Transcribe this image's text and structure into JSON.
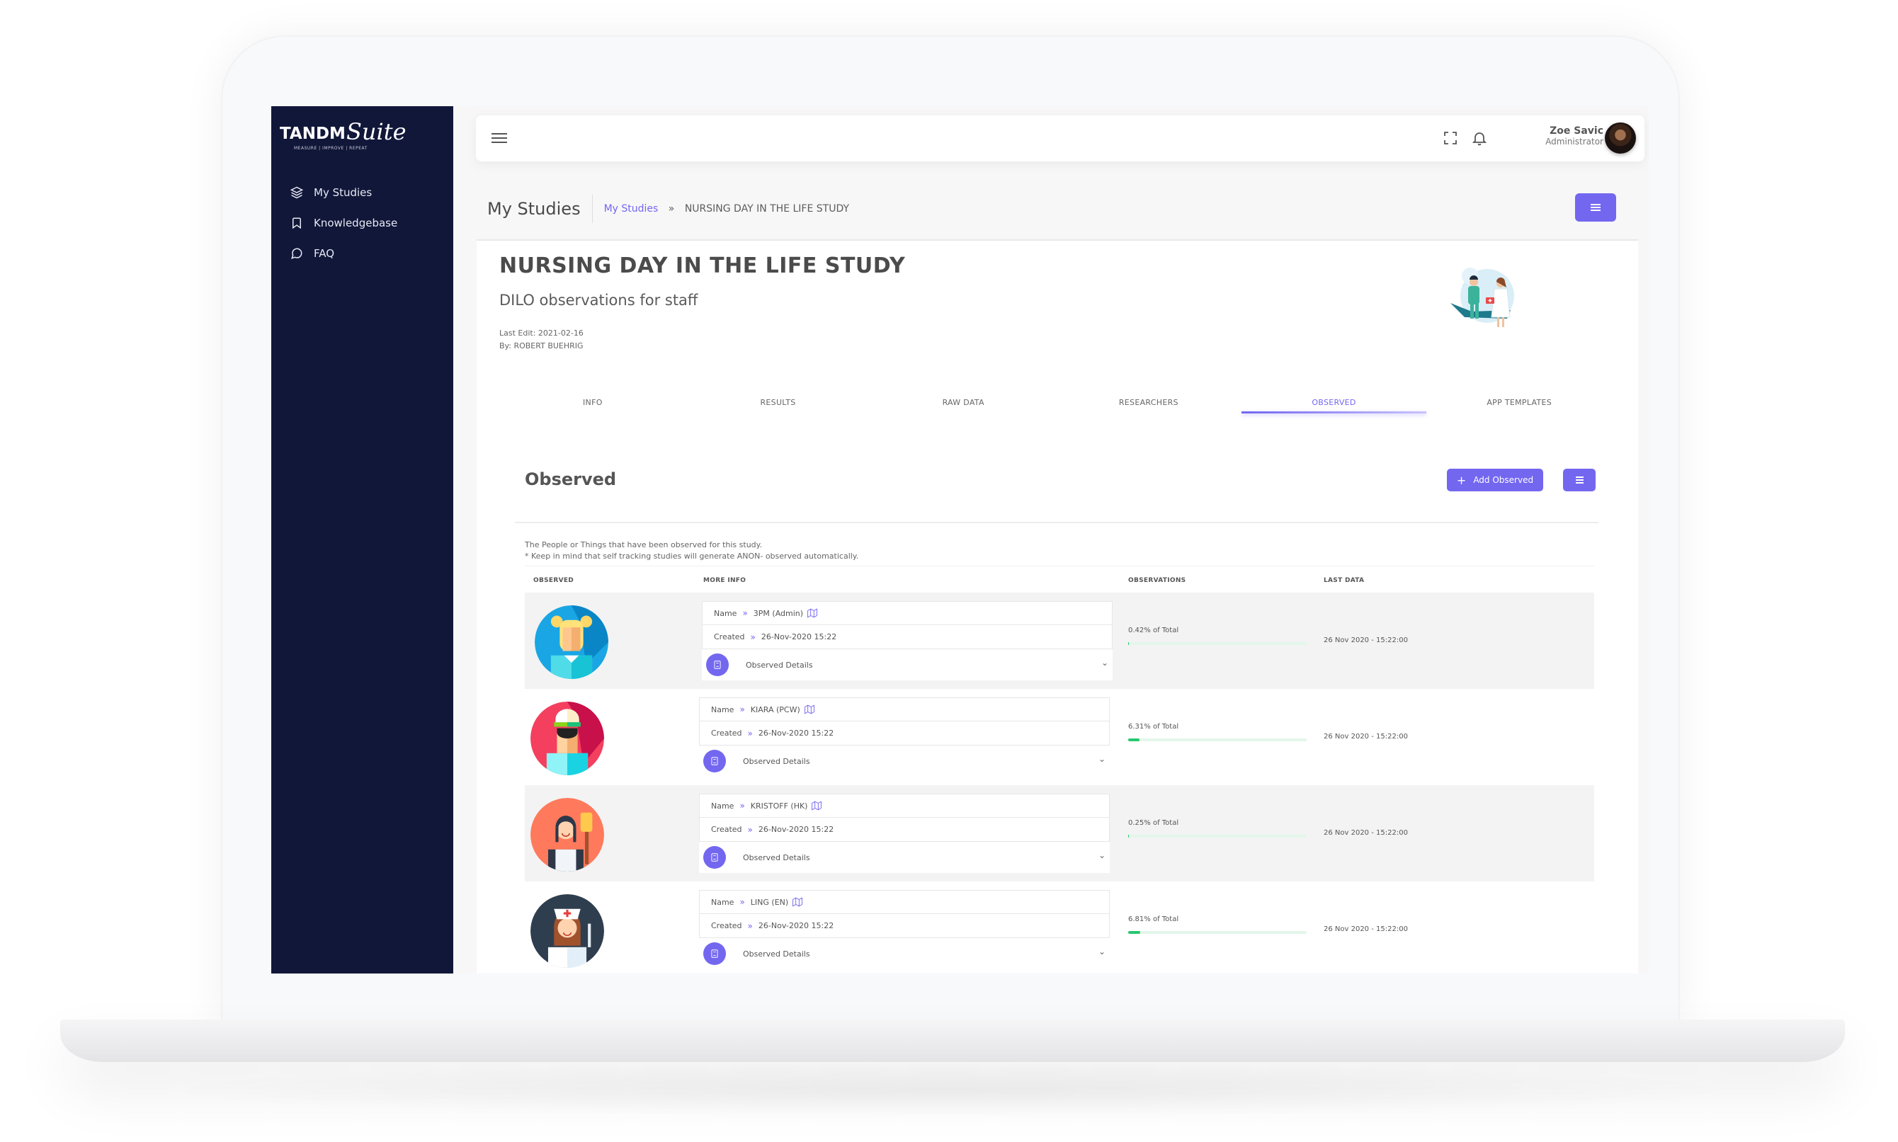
{
  "brand": {
    "name_bold": "TANDM",
    "name_script": "Suite",
    "tagline": "MEASURE | IMPROVE | REPEAT"
  },
  "sidebar": {
    "items": [
      {
        "label": "My Studies",
        "icon": "layers-icon"
      },
      {
        "label": "Knowledgebase",
        "icon": "bookmark-icon"
      },
      {
        "label": "FAQ",
        "icon": "message-circle-icon"
      }
    ]
  },
  "topbar": {
    "icons": [
      "menu-icon",
      "fullscreen-icon",
      "bell-icon"
    ],
    "user": {
      "name": "Zoe Savic",
      "role": "Administrator"
    }
  },
  "page": {
    "title": "My Studies",
    "breadcrumb": {
      "link": "My Studies",
      "separator": "»",
      "current": "NURSING DAY IN THE LIFE STUDY"
    }
  },
  "study": {
    "title": "NURSING DAY IN THE LIFE STUDY",
    "subtitle": "DILO observations for staff",
    "last_edit": "Last Edit: 2021-02-16",
    "by": "By: ROBERT BUEHRIG"
  },
  "tabs": [
    {
      "label": "INFO",
      "active": false
    },
    {
      "label": "RESULTS",
      "active": false
    },
    {
      "label": "RAW DATA",
      "active": false
    },
    {
      "label": "RESEARCHERS",
      "active": false
    },
    {
      "label": "OBSERVED",
      "active": true
    },
    {
      "label": "APP TEMPLATES",
      "active": false
    }
  ],
  "observed": {
    "title": "Observed",
    "add_button": "Add Observed",
    "add_icon": "+",
    "description_1": "The People or Things that have been observed for this study.",
    "description_2": "* Keep in mind that self tracking studies will generate ANON- observed automatically.",
    "columns": [
      "OBSERVED",
      "MORE INFO",
      "OBSERVATIONS",
      "LAST DATA"
    ],
    "name_label": "Name",
    "created_label": "Created",
    "arrow": "»",
    "details_label": "Observed Details",
    "rows": [
      {
        "name": "3PM (Admin)",
        "created": "26-Nov-2020 15:22",
        "percent": 0.42,
        "percent_text": "0.42% of Total",
        "last_data": "26 Nov 2020 - 15:22:00",
        "avatar": "blonde-staff-avatar"
      },
      {
        "name": "KIARA (PCW)",
        "created": "26-Nov-2020 15:22",
        "percent": 6.31,
        "percent_text": "6.31% of Total",
        "last_data": "26 Nov 2020 - 15:22:00",
        "avatar": "cap-worker-avatar"
      },
      {
        "name": "KRISTOFF (HK)",
        "created": "26-Nov-2020 15:22",
        "percent": 0.25,
        "percent_text": "0.25% of Total",
        "last_data": "26 Nov 2020 - 15:22:00",
        "avatar": "housekeeper-avatar"
      },
      {
        "name": "LING (EN)",
        "created": "26-Nov-2020 15:22",
        "percent": 6.81,
        "percent_text": "6.81% of Total",
        "last_data": "26 Nov 2020 - 15:22:00",
        "avatar": "nurse-avatar"
      }
    ]
  },
  "colors": {
    "accent": "#7367f0",
    "sidebar": "#111739",
    "success": "#28c76f"
  }
}
